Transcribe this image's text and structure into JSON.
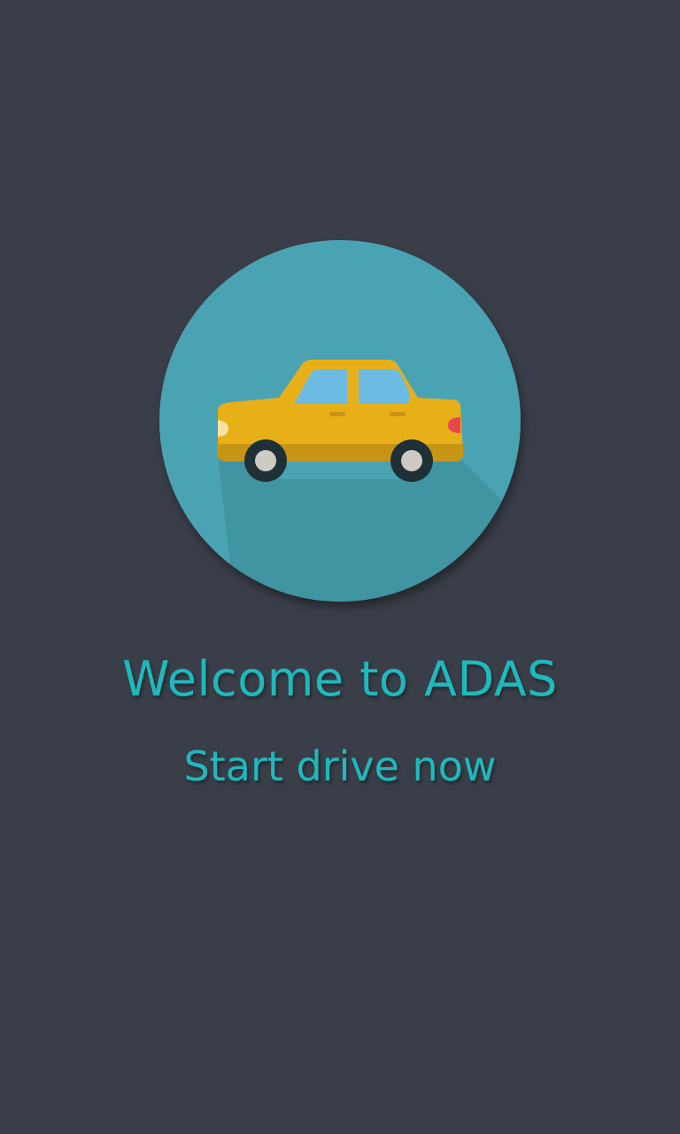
{
  "app": {
    "title": "Welcome to ADAS",
    "subtitle": "Start drive now"
  },
  "logo": {
    "icon": "car-icon"
  },
  "colors": {
    "background": "#393e48",
    "accent_text": "#1fb9bd",
    "circle": "#4aa3b3",
    "car_body": "#e8b018",
    "car_lower": "#c79516",
    "window": "#6cbbe3",
    "tire": "#1f3137",
    "hub": "#cfcac4",
    "tail_light": "#e8454e",
    "head_light": "#f6e3a3"
  }
}
